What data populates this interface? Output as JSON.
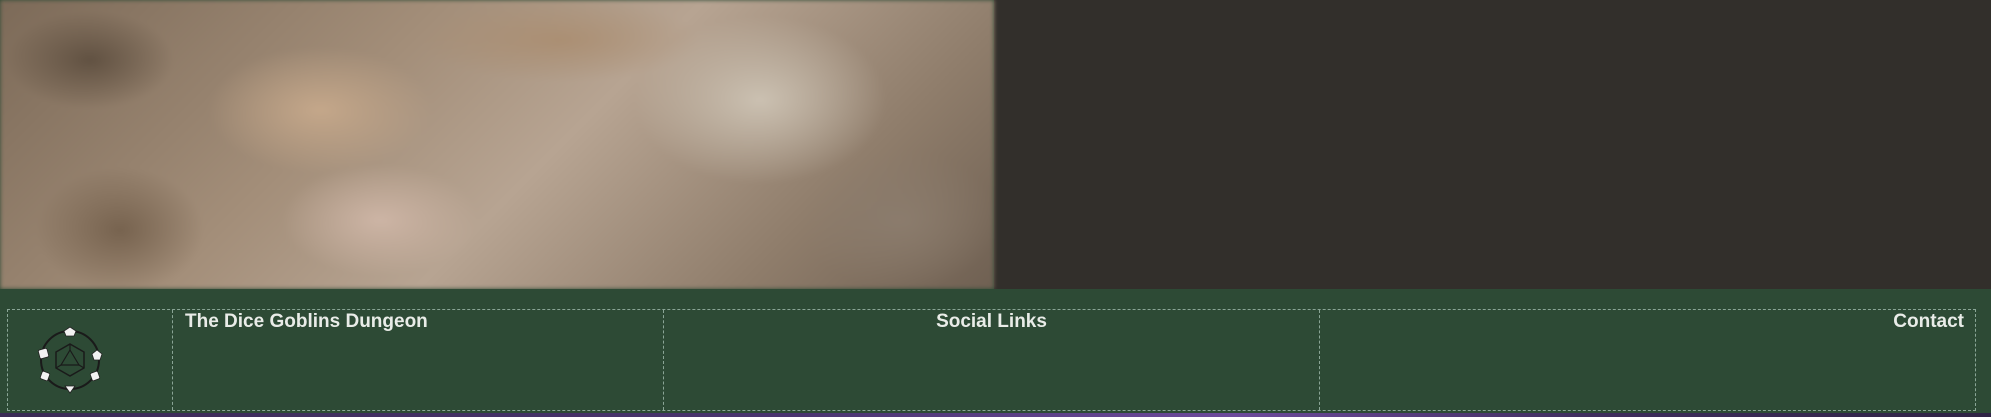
{
  "hero": {
    "image_alt": "blurred photo banner"
  },
  "footer": {
    "brand_heading": "The Dice Goblins Dungeon",
    "social_heading": "Social Links",
    "contact_heading": "Contact",
    "logo_icon": "dice-ring-logo-icon"
  },
  "colors": {
    "footer_bg": "#2d4a35",
    "hero_dark_bg": "#322f2b",
    "heading_text": "#e9ece8",
    "bottom_bar_accent": "#6d4a9c"
  }
}
